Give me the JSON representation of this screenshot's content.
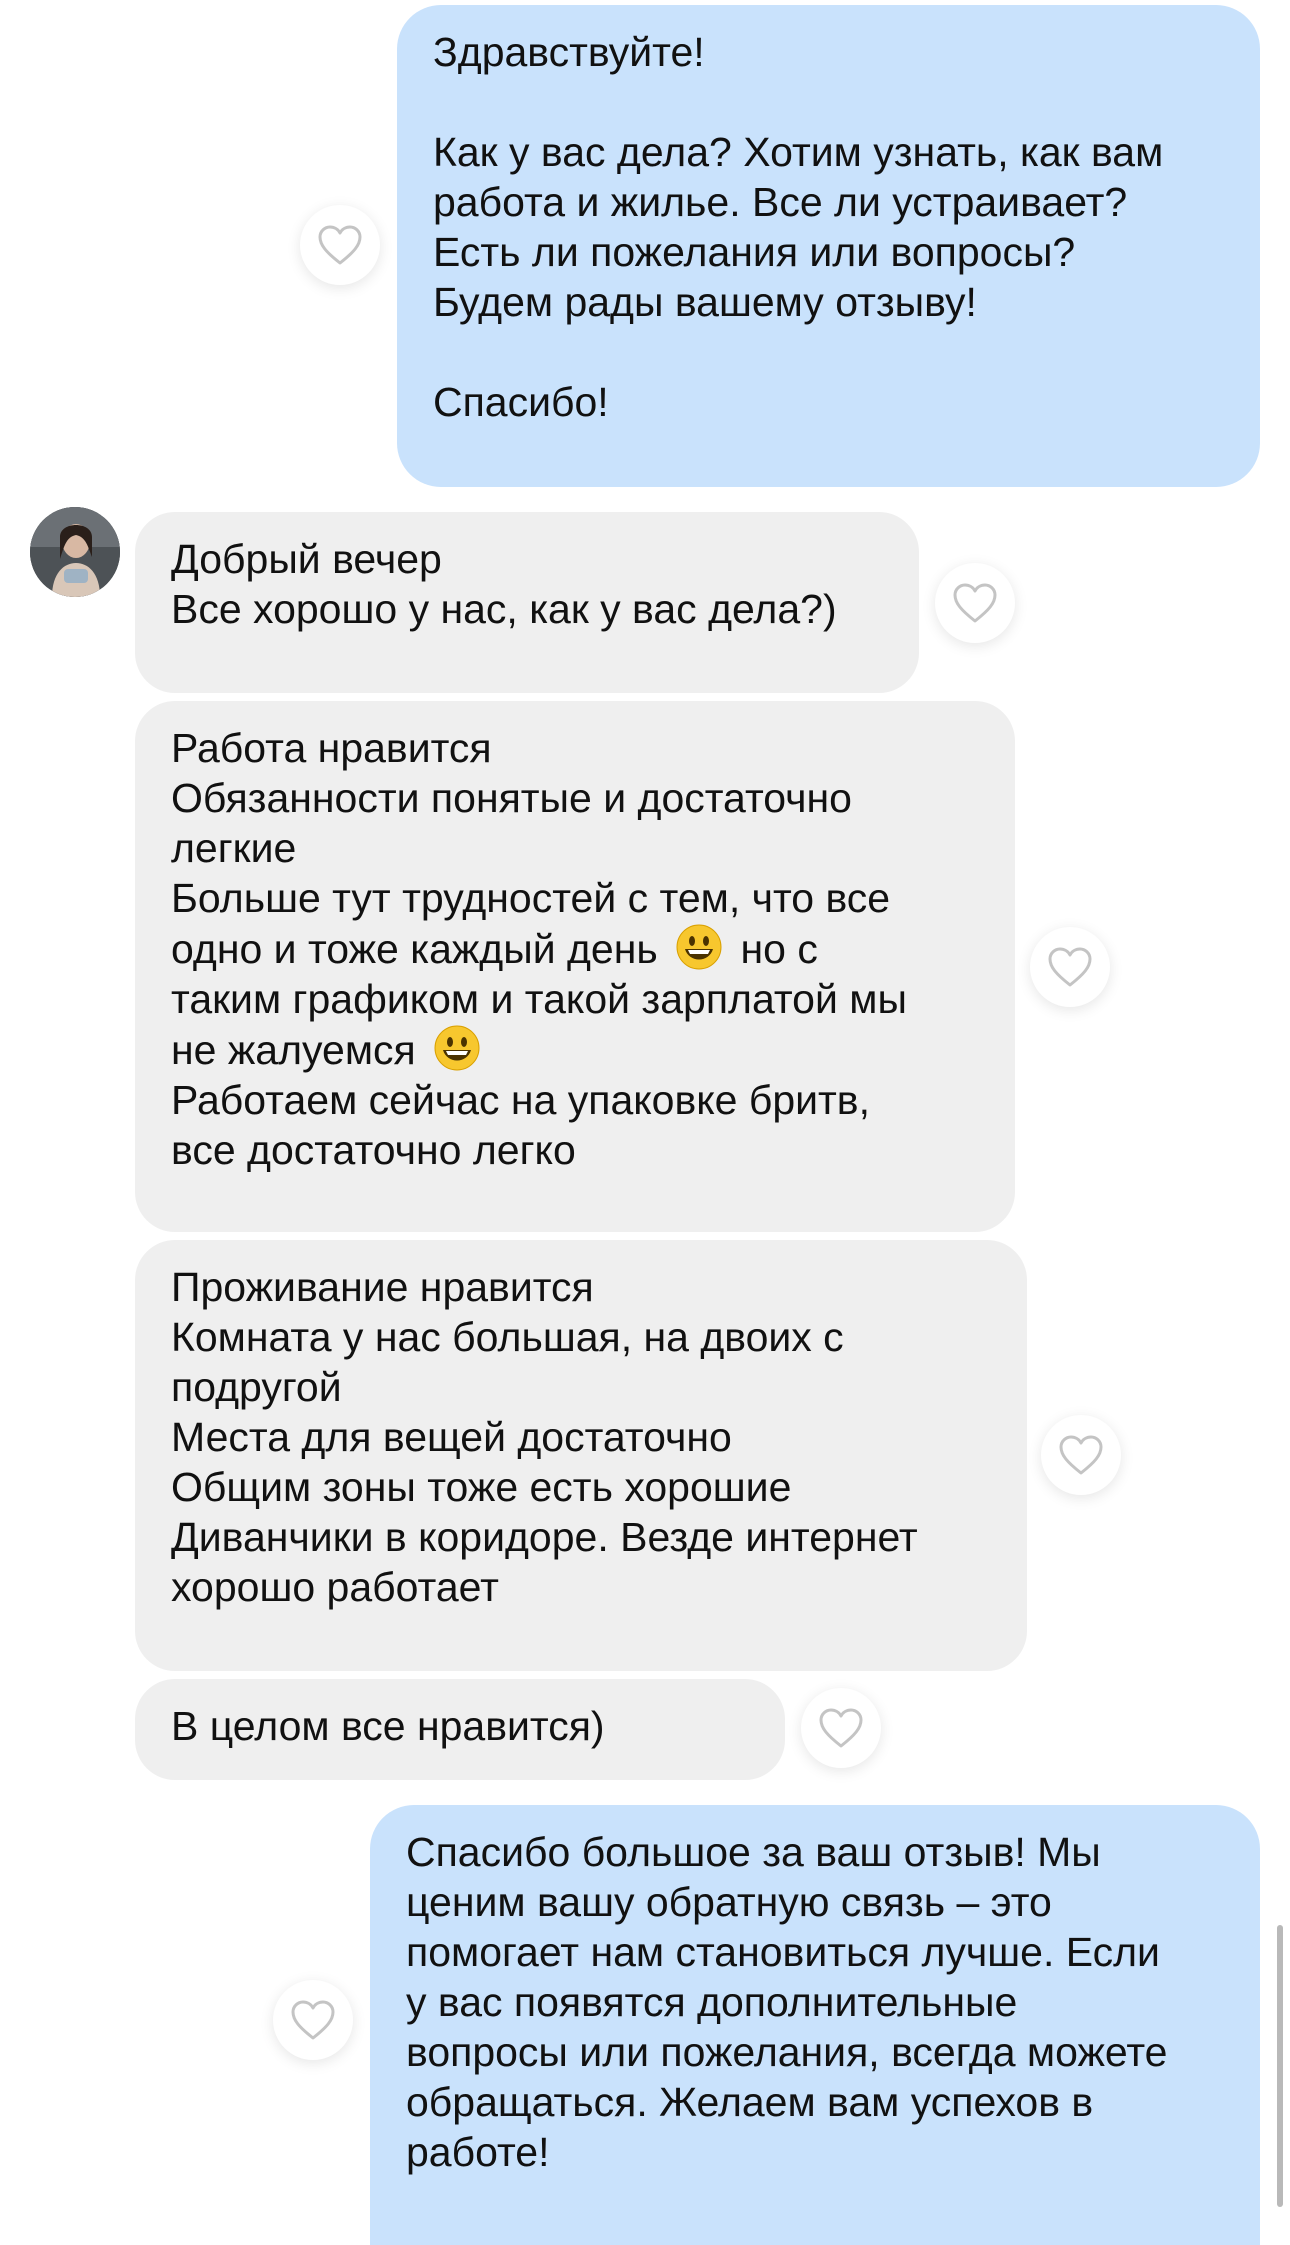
{
  "conversation": {
    "messages": [
      {
        "id": "m1",
        "direction": "outgoing",
        "lines": [
          "Здравствуйте!",
          "",
          "Как у вас дела? Хотим узнать, как вам",
          "работа и жилье. Все ли устраивает?",
          "Есть ли пожелания или вопросы?",
          "Будем рады вашему отзыву!",
          "",
          "Спасибо!"
        ]
      },
      {
        "id": "m2",
        "direction": "incoming",
        "lines": [
          "Добрый вечер",
          "Все хорошо у нас, как у вас дела?)"
        ]
      },
      {
        "id": "m3",
        "direction": "incoming",
        "lines": [
          "Работа нравится",
          "Обязанности понятые и достаточно",
          "легкие",
          "Больше тут трудностей с тем, что все",
          "одно и тоже каждый день",
          "но с",
          "таким графиком и такой зарплатой мы",
          "не жалуемся",
          "Работаем сейчас на упаковке бритв,",
          "все достаточно легко"
        ]
      },
      {
        "id": "m4",
        "direction": "incoming",
        "lines": [
          "Проживание нравится",
          "Комната у нас большая, на двоих с",
          "подругой",
          "Места для вещей достаточно",
          "Общим зоны тоже есть хорошие",
          "Диванчики в коридоре. Везде интернет",
          "хорошо работает"
        ]
      },
      {
        "id": "m5",
        "direction": "incoming",
        "lines": [
          "В целом все нравится)"
        ]
      },
      {
        "id": "m6",
        "direction": "outgoing",
        "lines": [
          "Спасибо большое за ваш отзыв! Мы",
          "ценим вашу обратную связь – это",
          "помогает нам становиться лучше. Если",
          "у вас появятся дополнительные",
          "вопросы или пожелания, всегда можете",
          "обращаться. Желаем вам успехов в",
          "работе!"
        ]
      }
    ],
    "emoji_name": "grinning-face-emoji",
    "heart_icon": "heart-outline-icon"
  },
  "colors": {
    "outgoing_bubble": "#c9e2fc",
    "incoming_bubble": "#efefef",
    "text": "#111111",
    "heart_stroke": "#c4c4c4"
  }
}
